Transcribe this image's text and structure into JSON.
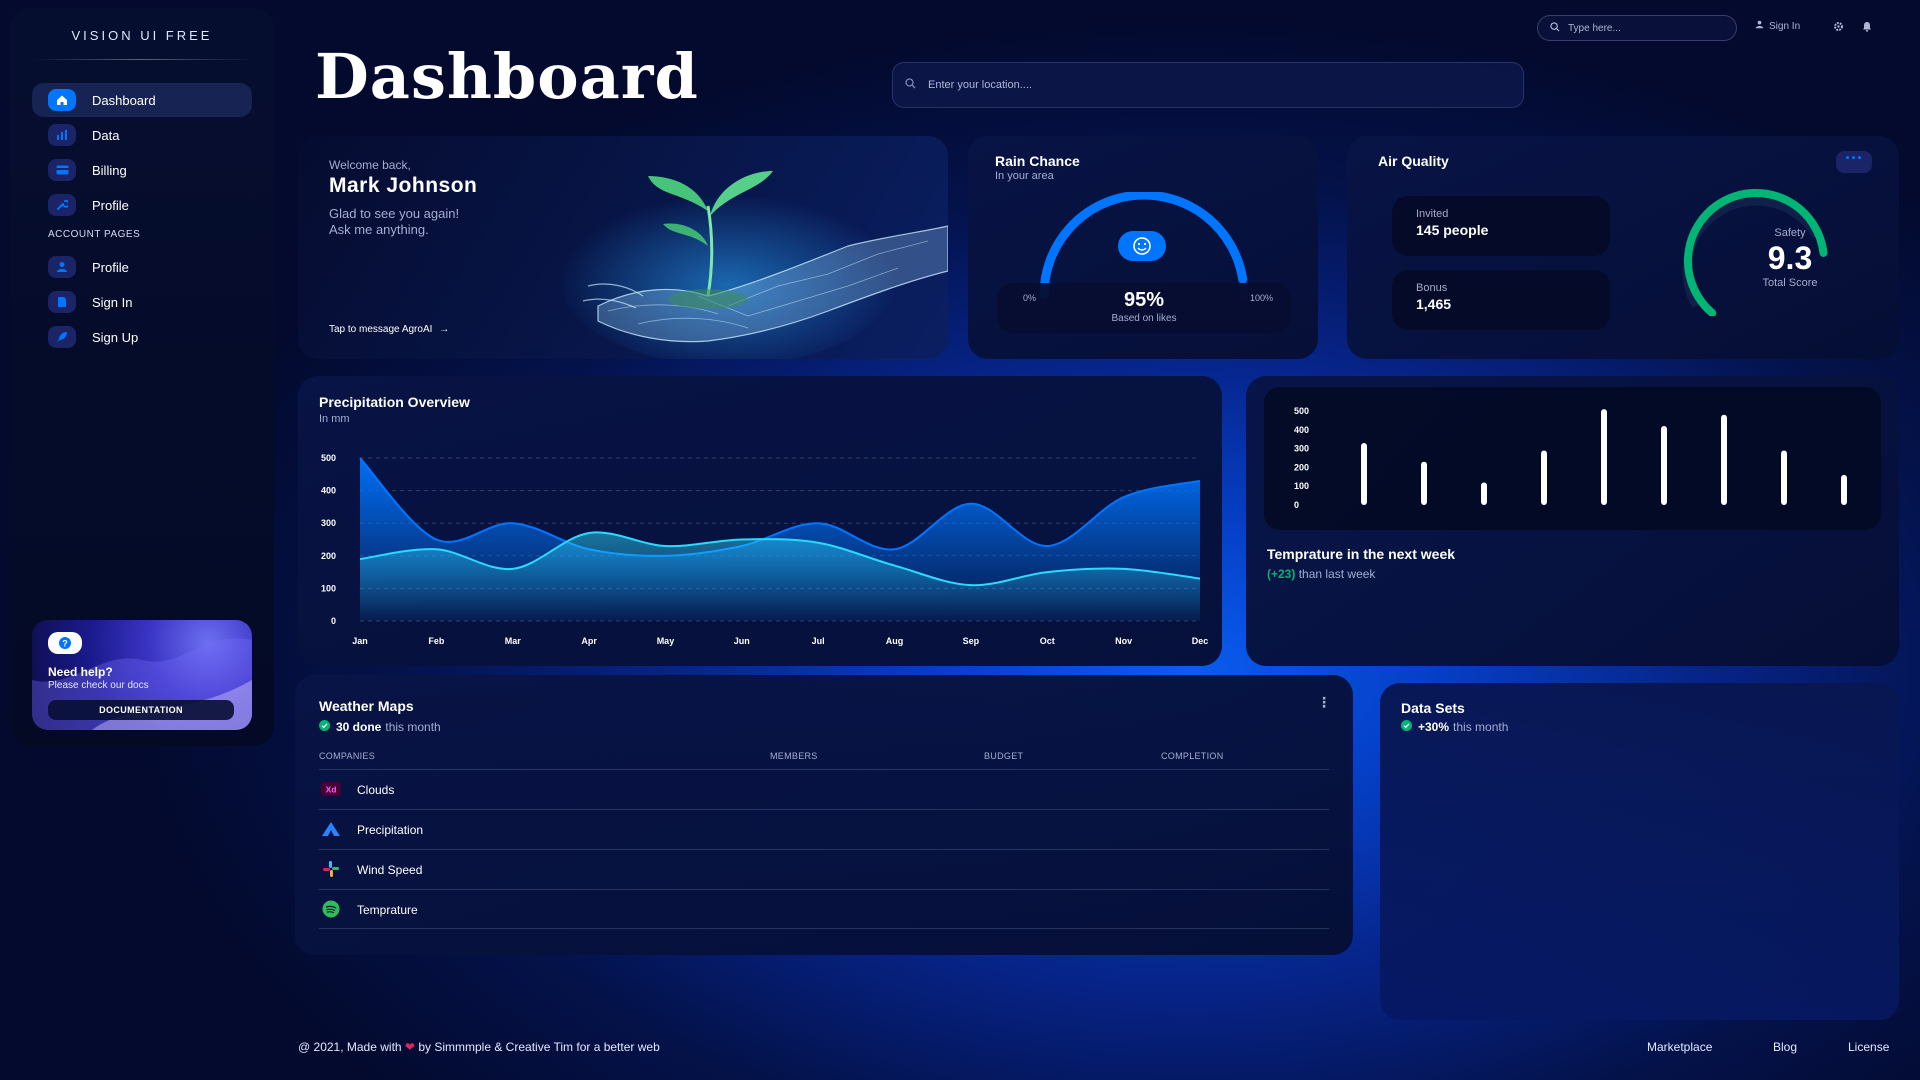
{
  "brand": "VISION UI FREE",
  "sidebar": {
    "items": [
      {
        "label": "Dashboard",
        "icon": "home-icon"
      },
      {
        "label": "Data",
        "icon": "chart-icon"
      },
      {
        "label": "Billing",
        "icon": "card-icon"
      },
      {
        "label": "Profile",
        "icon": "wrench-icon"
      }
    ],
    "section_label": "ACCOUNT PAGES",
    "account_items": [
      {
        "label": "Profile",
        "icon": "user-icon"
      },
      {
        "label": "Sign In",
        "icon": "document-icon"
      },
      {
        "label": "Sign Up",
        "icon": "rocket-icon"
      }
    ],
    "help": {
      "title": "Need help?",
      "subtitle": "Please check our docs",
      "button": "DOCUMENTATION"
    }
  },
  "header": {
    "title": "Dashboard",
    "location_placeholder": "Enter your location....",
    "search_placeholder": "Type here...",
    "signin": "Sign In"
  },
  "welcome": {
    "greeting": "Welcome back,",
    "name": "Mark Johnson",
    "line1": "Glad to see you again!",
    "line2": "Ask me anything.",
    "link": "Tap to message AgroAI",
    "link_arrow": "→"
  },
  "rain": {
    "title": "Rain Chance",
    "subtitle": "In your area",
    "min": "0%",
    "max": "100%",
    "value": "95%",
    "value_fraction": 0.95,
    "caption": "Based on likes"
  },
  "air": {
    "title": "Air Quality",
    "menu": "···",
    "stats": [
      {
        "label": "Invited",
        "value": "145 people"
      },
      {
        "label": "Bonus",
        "value": "1,465"
      }
    ],
    "gauge_label": "Safety",
    "score": "9.3",
    "score_caption": "Total Score",
    "score_fraction": 0.93
  },
  "precip": {
    "title": "Precipitation Overview",
    "subtitle": "In mm"
  },
  "temp": {
    "title": "Temprature in the next week",
    "delta": "(+23)",
    "delta_suffix": "than last week"
  },
  "maps": {
    "title": "Weather Maps",
    "done": "30 done",
    "done_suffix": "this month",
    "columns": [
      "COMPANIES",
      "MEMBERS",
      "BUDGET",
      "COMPLETION"
    ],
    "rows": [
      {
        "name": "Clouds",
        "icon": "adobe-xd-icon"
      },
      {
        "name": "Precipitation",
        "icon": "atlassian-icon"
      },
      {
        "name": "Wind Speed",
        "icon": "slack-icon"
      },
      {
        "name": "Temprature",
        "icon": "spotify-icon"
      }
    ]
  },
  "datasets": {
    "title": "Data Sets",
    "delta": "+30%",
    "delta_suffix": "this month"
  },
  "footer": {
    "prefix": "@ 2021, Made with",
    "suffix": "by Simmmple & Creative Tim for a better web",
    "links": [
      "Marketplace",
      "Blog",
      "License"
    ]
  },
  "colors": {
    "accent": "#0075ff",
    "teal": "#01b574",
    "muted": "#a3aed0"
  },
  "chart_data": [
    {
      "type": "area",
      "title": "Precipitation Overview",
      "subtitle": "In mm",
      "categories": [
        "Jan",
        "Feb",
        "Mar",
        "Apr",
        "May",
        "Jun",
        "Jul",
        "Aug",
        "Sep",
        "Oct",
        "Nov",
        "Dec"
      ],
      "yticks": [
        0,
        100,
        200,
        300,
        400,
        500
      ],
      "ylim": [
        0,
        500
      ],
      "series": [
        {
          "values": [
            500,
            250,
            300,
            220,
            200,
            230,
            300,
            220,
            360,
            230,
            380,
            430
          ],
          "color": "#0075ff"
        },
        {
          "values": [
            190,
            220,
            160,
            270,
            230,
            250,
            240,
            170,
            110,
            150,
            160,
            130
          ],
          "color": "#2cd9ff"
        }
      ],
      "grid": true
    },
    {
      "type": "bar",
      "yticks": [
        0,
        100,
        200,
        300,
        400,
        500
      ],
      "ylim": [
        0,
        500
      ],
      "values": [
        330,
        230,
        120,
        290,
        510,
        420,
        480,
        290,
        160
      ],
      "bar_color": "#ffffff"
    }
  ]
}
